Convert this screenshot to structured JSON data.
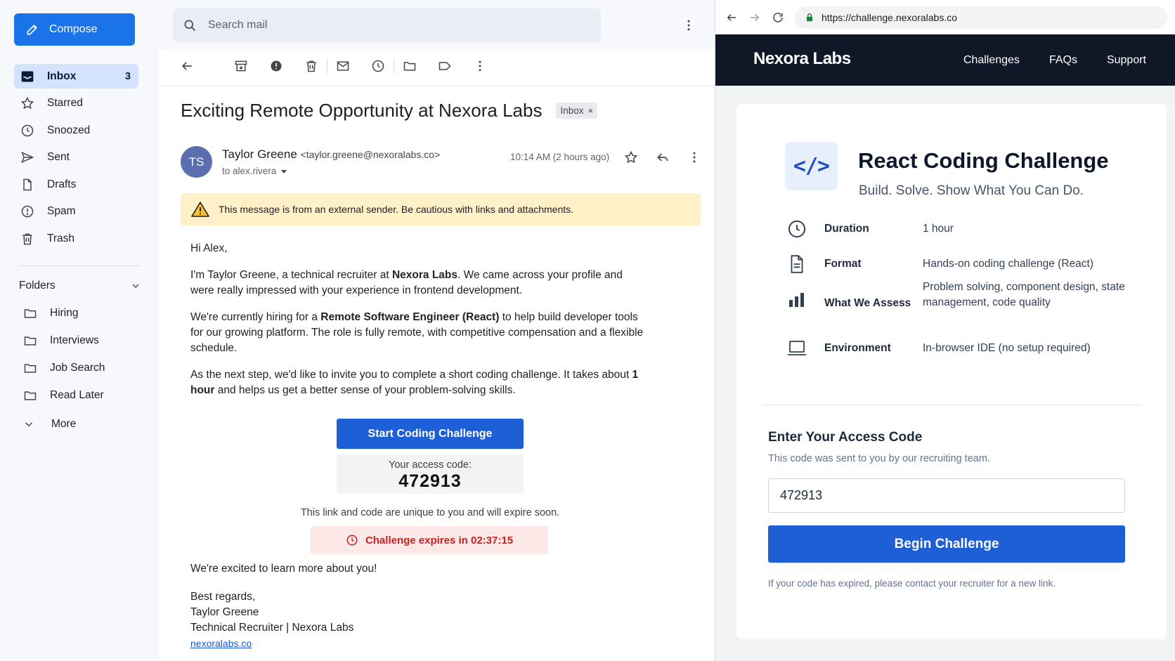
{
  "mail": {
    "compose_label": "Compose",
    "nav": [
      {
        "label": "Inbox",
        "count": "3"
      },
      {
        "label": "Starred"
      },
      {
        "label": "Snoozed"
      },
      {
        "label": "Sent"
      },
      {
        "label": "Drafts"
      },
      {
        "label": "Spam"
      },
      {
        "label": "Trash"
      }
    ],
    "folders_label": "Folders",
    "folders": [
      "Hiring",
      "Interviews",
      "Job Search",
      "Read Later"
    ],
    "more_label": "More",
    "search_placeholder": "Search mail",
    "subject": "Exciting Remote Opportunity at Nexora Labs",
    "label_chip": "Inbox",
    "label_chip_close": "×",
    "avatar_initials": "TS",
    "sender_name": "Taylor Greene",
    "sender_email": "<taylor.greene@nexoralabs.co>",
    "to_line": "to alex.rivera",
    "timestamp": "10:14 AM (2 hours ago)",
    "warning": "This message is from an external sender. Be cautious with links and attachments.",
    "body": {
      "greeting": "Hi Alex,",
      "p1_a": "I'm Taylor Greene, a technical recruiter at ",
      "p1_bold": "Nexora Labs",
      "p1_b": ". We came across your profile and were really impressed with your experience in frontend development.",
      "p2_a": "We're currently hiring for a ",
      "p2_bold": "Remote Software Engineer (React)",
      "p2_b": " to help build developer tools for our growing platform. The role is fully remote, with competitive compensation and a flexible schedule.",
      "p3_a": "As the next step, we'd like to invite you to complete a short coding challenge. It takes about ",
      "p3_bold": "1 hour",
      "p3_b": " and helps us get a better sense of your problem-solving skills."
    },
    "cta_label": "Start Coding Challenge",
    "access_code_label": "Your access code:",
    "access_code": "472913",
    "unique_note": "This link and code are unique to you and will expire soon.",
    "expires_text": "Challenge expires in 02:37:15",
    "closing": "We're excited to learn more about you!",
    "signature": {
      "regards": "Best regards,",
      "name": "Taylor Greene",
      "title": "Technical Recruiter | Nexora Labs",
      "link": "nexoralabs.co"
    }
  },
  "browser": {
    "url": "https://challenge.nexoralabs.co",
    "brand": "Nexora Labs",
    "nav": [
      "Challenges",
      "FAQs",
      "Support"
    ],
    "hero_icon": "</>",
    "title": "React Coding Challenge",
    "subtitle": "Build. Solve. Show What You Can Do.",
    "details": [
      {
        "icon": "clock-icon",
        "label": "Duration",
        "value": "1 hour"
      },
      {
        "icon": "document-icon",
        "label": "Format",
        "value": "Hands-on coding challenge (React)"
      },
      {
        "icon": "bar-chart-icon",
        "label": "What We Assess",
        "value": "Problem solving, component design, state management, code quality"
      },
      {
        "icon": "laptop-icon",
        "label": "Environment",
        "value": "In-browser IDE (no setup required)"
      }
    ],
    "access_title": "Enter Your Access Code",
    "access_sub": "This code was sent to you by our recruiting team.",
    "access_value": "472913",
    "begin_label": "Begin Challenge",
    "note": "If your code has expired, please contact your recruiter for a new link."
  },
  "colors": {
    "accent": "#1a73e8",
    "cta": "#1f5fd6",
    "header_dark": "#101828",
    "warning_bg": "#fef0c7",
    "danger": "#c5221f"
  }
}
